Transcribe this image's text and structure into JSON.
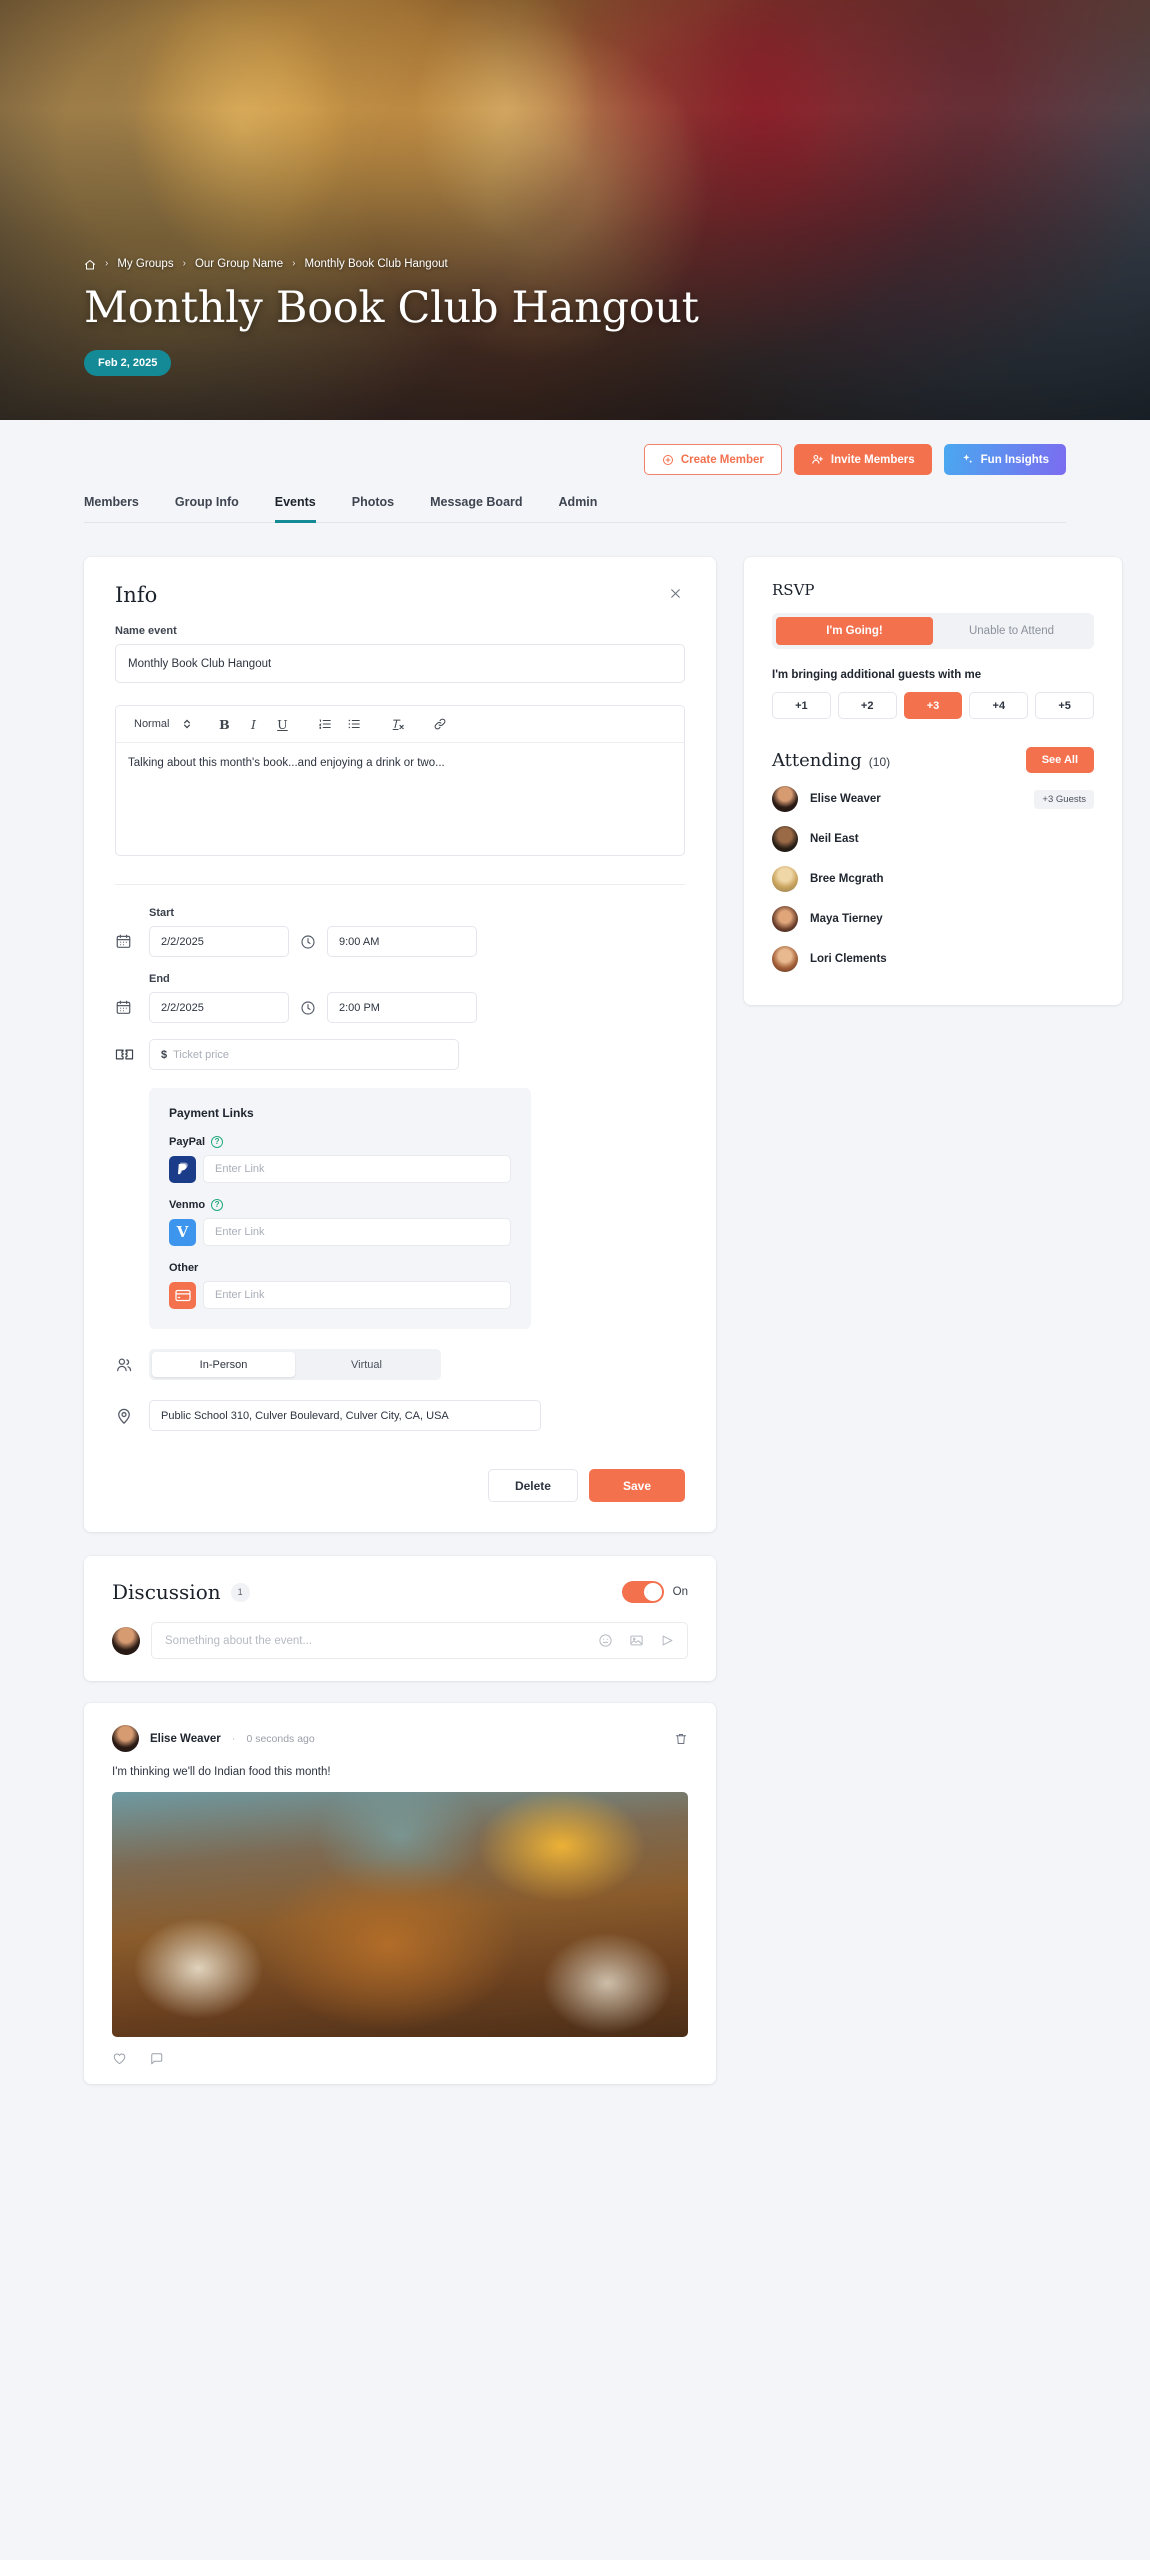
{
  "hero": {
    "breadcrumb": [
      {
        "label": "home-icon",
        "icon": "home"
      },
      {
        "label": "My Groups"
      },
      {
        "label": "Our Group Name"
      },
      {
        "label": "Monthly Book Club Hangout"
      }
    ],
    "title": "Monthly Book Club Hangout",
    "date_pill": "Feb 2, 2025",
    "date_pill_color": "#138a96"
  },
  "actionbar": {
    "create_member": "Create Member",
    "invite_members": "Invite Members",
    "fun_insights": "Fun Insights",
    "orange": "#f4714e"
  },
  "tabs": [
    {
      "label": "Members",
      "active": false
    },
    {
      "label": "Group Info",
      "active": false
    },
    {
      "label": "Events",
      "active": true
    },
    {
      "label": "Photos",
      "active": false
    },
    {
      "label": "Message Board",
      "active": false
    },
    {
      "label": "Admin",
      "active": false
    }
  ],
  "info": {
    "title": "Info",
    "name_label": "Name event",
    "name_value": "Monthly Book Club Hangout",
    "toolbar": {
      "style_select": "Normal",
      "bold": "B",
      "italic": "I",
      "underline": "U"
    },
    "description": "Talking about this month's book...and enjoying a drink or two...",
    "start_label": "Start",
    "start_date": "2/2/2025",
    "start_time": "9:00 AM",
    "end_label": "End",
    "end_date": "2/2/2025",
    "end_time": "2:00 PM",
    "ticket_symbol": "$",
    "ticket_placeholder": "Ticket price",
    "payment": {
      "title": "Payment Links",
      "paypal_label": "PayPal",
      "paypal_placeholder": "Enter Link",
      "venmo_label": "Venmo",
      "venmo_placeholder": "Enter Link",
      "other_label": "Other",
      "other_placeholder": "Enter Link"
    },
    "location_modes": [
      {
        "label": "In-Person",
        "active": true
      },
      {
        "label": "Virtual",
        "active": false
      }
    ],
    "address": "Public School 310, Culver Boulevard, Culver City, CA, USA",
    "delete_label": "Delete",
    "save_label": "Save"
  },
  "rsvp": {
    "title": "RSVP",
    "options": [
      {
        "label": "I'm Going!",
        "active": true
      },
      {
        "label": "Unable to Attend",
        "active": false
      }
    ],
    "guests_label": "I'm bringing additional guests with me",
    "guest_options": [
      {
        "label": "+1",
        "active": false
      },
      {
        "label": "+2",
        "active": false
      },
      {
        "label": "+3",
        "active": true
      },
      {
        "label": "+4",
        "active": false
      },
      {
        "label": "+5",
        "active": false
      }
    ]
  },
  "attending": {
    "title": "Attending",
    "count": "(10)",
    "see_all": "See All",
    "people": [
      {
        "name": "Elise Weaver",
        "badge": "+3 Guests"
      },
      {
        "name": "Neil East",
        "badge": ""
      },
      {
        "name": "Bree Mcgrath",
        "badge": ""
      },
      {
        "name": "Maya Tierney",
        "badge": ""
      },
      {
        "name": "Lori Clements",
        "badge": ""
      }
    ]
  },
  "discussion": {
    "title": "Discussion",
    "count": "1",
    "toggle_label": "On",
    "toggle_on": true,
    "input_placeholder": "Something about the event...",
    "post": {
      "author": "Elise Weaver",
      "separator": "·",
      "time": "0 seconds ago",
      "text": "I'm thinking we'll do Indian food this month!"
    }
  }
}
